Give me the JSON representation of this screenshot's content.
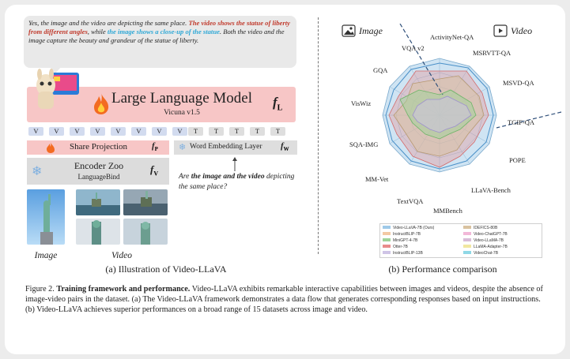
{
  "bubble": {
    "part1": "Yes, the image and the video are depicting the same place. ",
    "part2": "The video shows the statue of liberty from different angles",
    "part3": ", while ",
    "part4": "the image shows a close-up of the statue",
    "part5": ". Both the video and the image capture the beauty and grandeur of the statue of liberty."
  },
  "llm": {
    "title": "Large Language Model",
    "subtitle": "Vicuna v1.5",
    "symbol": "f",
    "symbol_sub": "L"
  },
  "tokens": {
    "visual": [
      "V",
      "V",
      "V",
      "V",
      "V",
      "V",
      "V",
      "V"
    ],
    "text": [
      "T",
      "T",
      "T",
      "T",
      "T"
    ]
  },
  "share_projection": {
    "label": "Share Projection",
    "symbol": "f",
    "symbol_sub": "P"
  },
  "word_embedding": {
    "label": "Word Embedding Layer",
    "symbol": "f",
    "symbol_sub": "W"
  },
  "encoder": {
    "title": "Encoder Zoo",
    "subtitle": "LanguageBind",
    "symbol": "f",
    "symbol_sub": "V"
  },
  "question": {
    "part1": "Are ",
    "part2": "the image and the video",
    "part3": " depicting the same place?"
  },
  "labels": {
    "image": "Image",
    "video": "Video",
    "left_caption": "(a) Illustration of Video-LLaVA",
    "right_caption": "(b) Performance comparison",
    "radar_image": "Image",
    "radar_video": "Video"
  },
  "figure_caption": {
    "prefix": "Figure 2. ",
    "bold": "Training framework and performance.",
    "text": " Video-LLaVA exhibits remarkable interactive capabilities between images and videos, despite the absence of image-video pairs in the dataset. (a) The Video-LLaVA framework demonstrates a data flow that generates corresponding responses based on input instructions. (b) Video-LLaVA achieves superior performances on a broad range of 15 datasets across image and video."
  },
  "colors": {
    "llm_pink": "#f7c6c6",
    "token_blue": "#d2dbef",
    "red_text": "#c0392b",
    "blue_text": "#2ea8d6"
  },
  "radar": {
    "axes": [
      "ActivityNet-QA",
      "MSRVTT-QA",
      "MSVD-QA",
      "TGIF-QA",
      "POPE",
      "LLaVA-Bench",
      "MMBench",
      "TextVQA",
      "MM-Vet",
      "SQA-IMG",
      "VisWiz",
      "GQA",
      "VQA v2"
    ],
    "legend": [
      {
        "name": "Video-LLaVA-7B (Ours)",
        "color": "#9ec9e8"
      },
      {
        "name": "IDEFICS-80B",
        "color": "#d9c2a0"
      },
      {
        "name": "InstructBLIP-7B",
        "color": "#f3c9a4"
      },
      {
        "name": "Video-ChatGPT-7B",
        "color": "#f2b8d8"
      },
      {
        "name": "MiniGPT-4-7B",
        "color": "#9fd49a"
      },
      {
        "name": "Video-LLaMA-7B",
        "color": "#d8bcd8"
      },
      {
        "name": "Otter-7B",
        "color": "#e88c8c"
      },
      {
        "name": "LLaMA-Adapter-7B",
        "color": "#f1e7a0"
      },
      {
        "name": "InstructBLIP-13B",
        "color": "#cfc4e6"
      },
      {
        "name": "VideoChat-7B",
        "color": "#8fd8e6"
      }
    ]
  }
}
